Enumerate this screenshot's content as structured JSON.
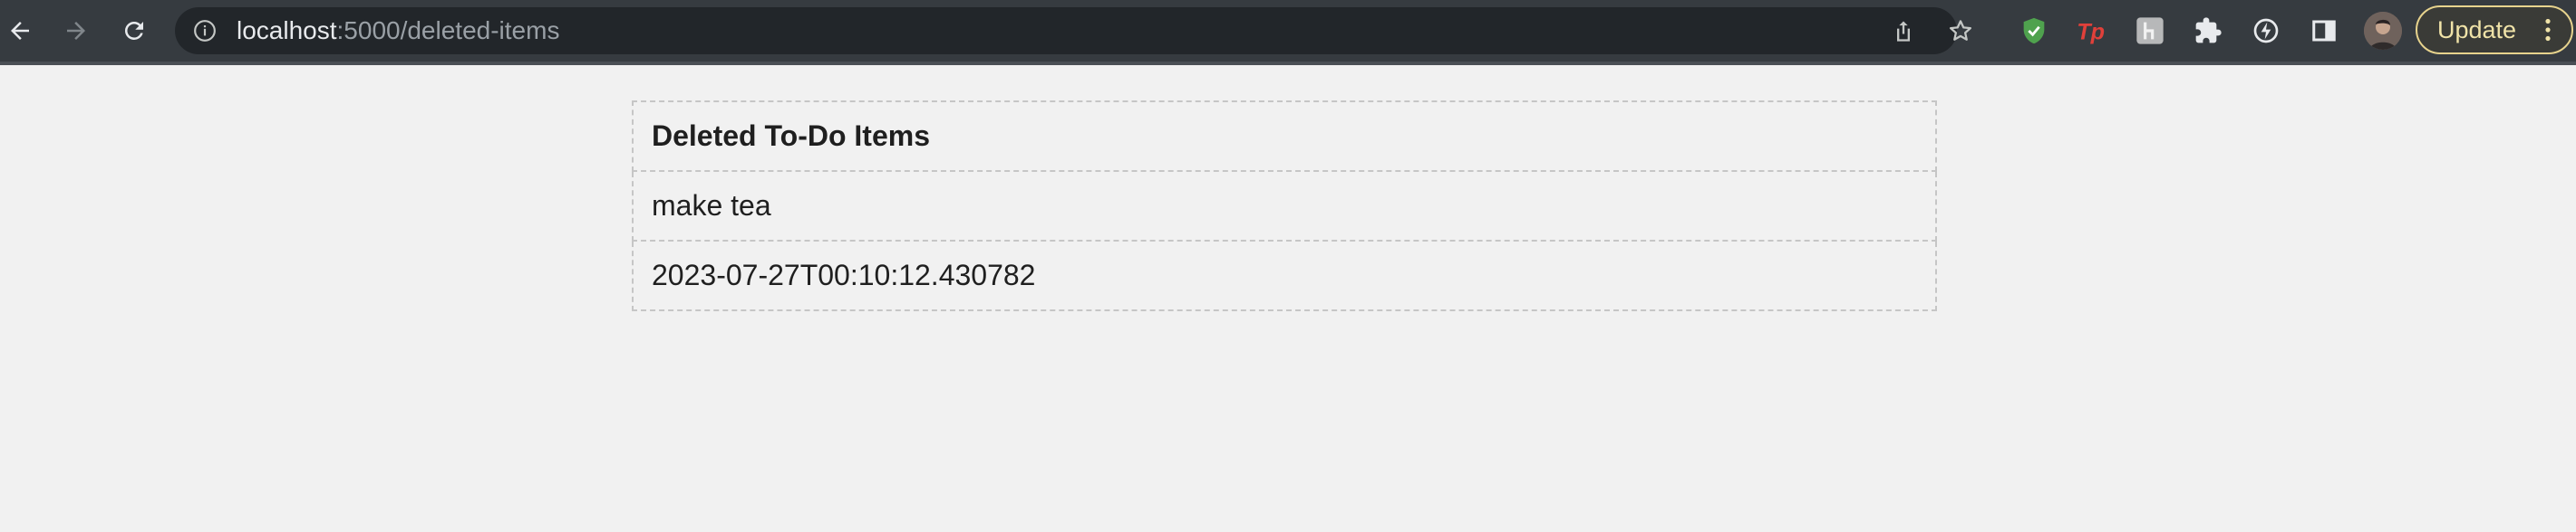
{
  "browser": {
    "url_host": "localhost",
    "url_path": ":5000/deleted-items",
    "update_label": "Update",
    "extension_icons": [
      "shield-check-icon",
      "tp-extension-icon",
      "h-extension-icon",
      "puzzle-icon",
      "sync-icon",
      "side-panel-icon"
    ],
    "colors": {
      "toolbar": "#363b40",
      "omnibox": "#22262a",
      "update_border": "#e7d38d",
      "tp_red": "#e0403a",
      "shield_green": "#4fa24e"
    }
  },
  "page": {
    "table": {
      "header": "Deleted To-Do Items",
      "rows": [
        "make tea",
        "2023-07-27T00:10:12.430782"
      ]
    }
  }
}
